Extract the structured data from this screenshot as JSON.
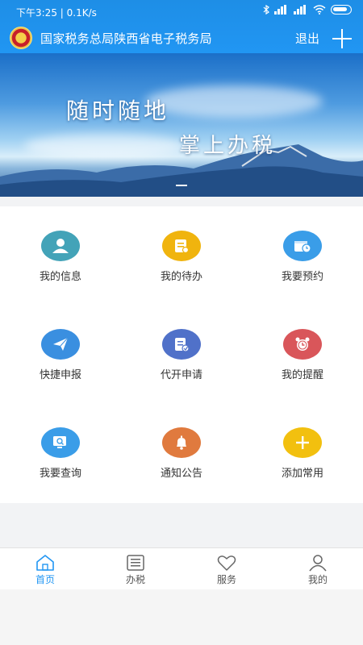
{
  "status_bar": {
    "time_speed": "下午3:25 | 0.1K/s"
  },
  "header": {
    "title": "国家税务总局陕西省电子税务局",
    "logout_label": "退出",
    "plus_icon": "plus-icon",
    "emblem_icon": "tax-emblem-icon"
  },
  "banner": {
    "line1": "随时随地",
    "line2": "掌上办税"
  },
  "grid": [
    {
      "label": "我的信息",
      "icon": "user-icon",
      "color": "#43a3b8"
    },
    {
      "label": "我的待办",
      "icon": "todo-list-icon",
      "color": "#f0b40e"
    },
    {
      "label": "我要预约",
      "icon": "calendar-clock-icon",
      "color": "#3a9de8"
    },
    {
      "label": "快捷申报",
      "icon": "paper-plane-icon",
      "color": "#3a8fe0"
    },
    {
      "label": "代开申请",
      "icon": "edit-document-icon",
      "color": "#5071c9"
    },
    {
      "label": "我的提醒",
      "icon": "alarm-clock-icon",
      "color": "#d9565a"
    },
    {
      "label": "我要查询",
      "icon": "search-screen-icon",
      "color": "#3a9de8"
    },
    {
      "label": "通知公告",
      "icon": "bell-icon",
      "color": "#e07a3e"
    },
    {
      "label": "添加常用",
      "icon": "add-icon",
      "color": "#f2c00f"
    }
  ],
  "nav": [
    {
      "label": "首页",
      "icon": "home-icon",
      "active": true
    },
    {
      "label": "办税",
      "icon": "list-icon",
      "active": false
    },
    {
      "label": "服务",
      "icon": "heart-icon",
      "active": false
    },
    {
      "label": "我的",
      "icon": "person-icon",
      "active": false
    }
  ],
  "colors": {
    "primary": "#2196f3",
    "active_nav": "#2196f3"
  }
}
